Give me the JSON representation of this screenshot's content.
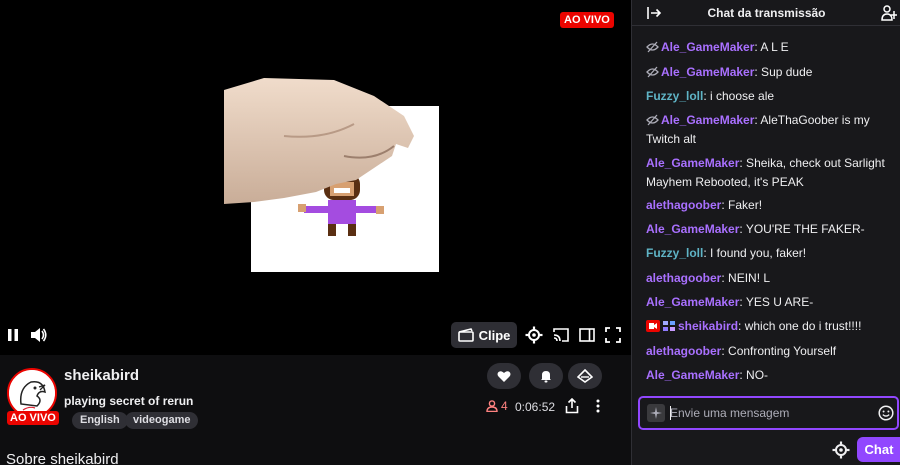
{
  "player": {
    "live_badge": "AO VIVO",
    "clip_label": "Clipe",
    "icons": [
      "pause-icon",
      "volume-icon",
      "clip-icon",
      "gear-icon",
      "cast-icon",
      "theatre-icon",
      "fullscreen-icon"
    ]
  },
  "channel": {
    "name": "sheikabird",
    "live_badge": "AO VIVO",
    "title": "playing secret of rerun",
    "tags": [
      "English",
      "videogame"
    ],
    "viewers": "4",
    "uptime": "0:06:52",
    "about_heading": "Sobre sheikabird"
  },
  "chat": {
    "title": "Chat da transmissão",
    "input_placeholder": "Envie uma mensagem",
    "send_label": "Chat",
    "colors": {
      "purple_user": "#a970ff",
      "blue_user": "#5fb4c6",
      "accent": "#9147ff",
      "live": "#eb0400"
    },
    "messages": [
      {
        "user": "Ale_GameMaker",
        "text": ": A L E"
      },
      {
        "user": "Ale_GameMaker",
        "text": ": Sup dude"
      },
      {
        "user": "Fuzzy_loll",
        "text": ": i choose ale"
      },
      {
        "user": "Ale_GameMaker",
        "text": ": AleThaGoober is my Twitch alt"
      },
      {
        "user": "Ale_GameMaker",
        "text": ": Sheika, check out Sarlight Mayhem Rebooted, it's PEAK"
      },
      {
        "user": "alethagoober",
        "text": ": Faker!"
      },
      {
        "user": "Ale_GameMaker",
        "text": ": YOU'RE THE FAKER-"
      },
      {
        "user": "Fuzzy_loll",
        "text": ": I found you, faker!"
      },
      {
        "user": "alethagoober",
        "text": ": NEIN! L"
      },
      {
        "user": "Ale_GameMaker",
        "text": ": YES U ARE-"
      },
      {
        "user": "sheikabird",
        "text": ": which one do i trust!!!!"
      },
      {
        "user": "alethagoober",
        "text": ": Confronting Yourself"
      },
      {
        "user": "Ale_GameMaker",
        "text": ": NO-"
      }
    ]
  }
}
